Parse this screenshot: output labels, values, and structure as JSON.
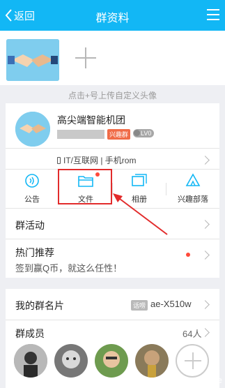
{
  "header": {
    "back_label": "返回",
    "title": "群资料"
  },
  "avatar_upload": {
    "hint": "点击+号上传自定义头像"
  },
  "group": {
    "name": "高尖端智能机团",
    "tag": "兴趣群",
    "level": "LV0",
    "category": "IT/互联网 | 手机rom"
  },
  "tabs": [
    {
      "label": "公告",
      "icon": "announcement-icon"
    },
    {
      "label": "文件",
      "icon": "folder-icon"
    },
    {
      "label": "相册",
      "icon": "album-icon"
    },
    {
      "label": "兴趣部落",
      "icon": "tribe-icon"
    }
  ],
  "activity": {
    "label": "群活动"
  },
  "hot": {
    "label": "热门推荐",
    "subtitle": "签到赢Q币，就这么任性！"
  },
  "card_name": {
    "label": "我的群名片",
    "badge": "话唠",
    "value": "ae-X510w"
  },
  "members": {
    "label": "群成员",
    "count": "64人"
  },
  "watermark": "cnline",
  "colors": {
    "accent": "#12b7f5",
    "highlight_red": "#e22b2b",
    "tag_orange": "#f06b47"
  }
}
